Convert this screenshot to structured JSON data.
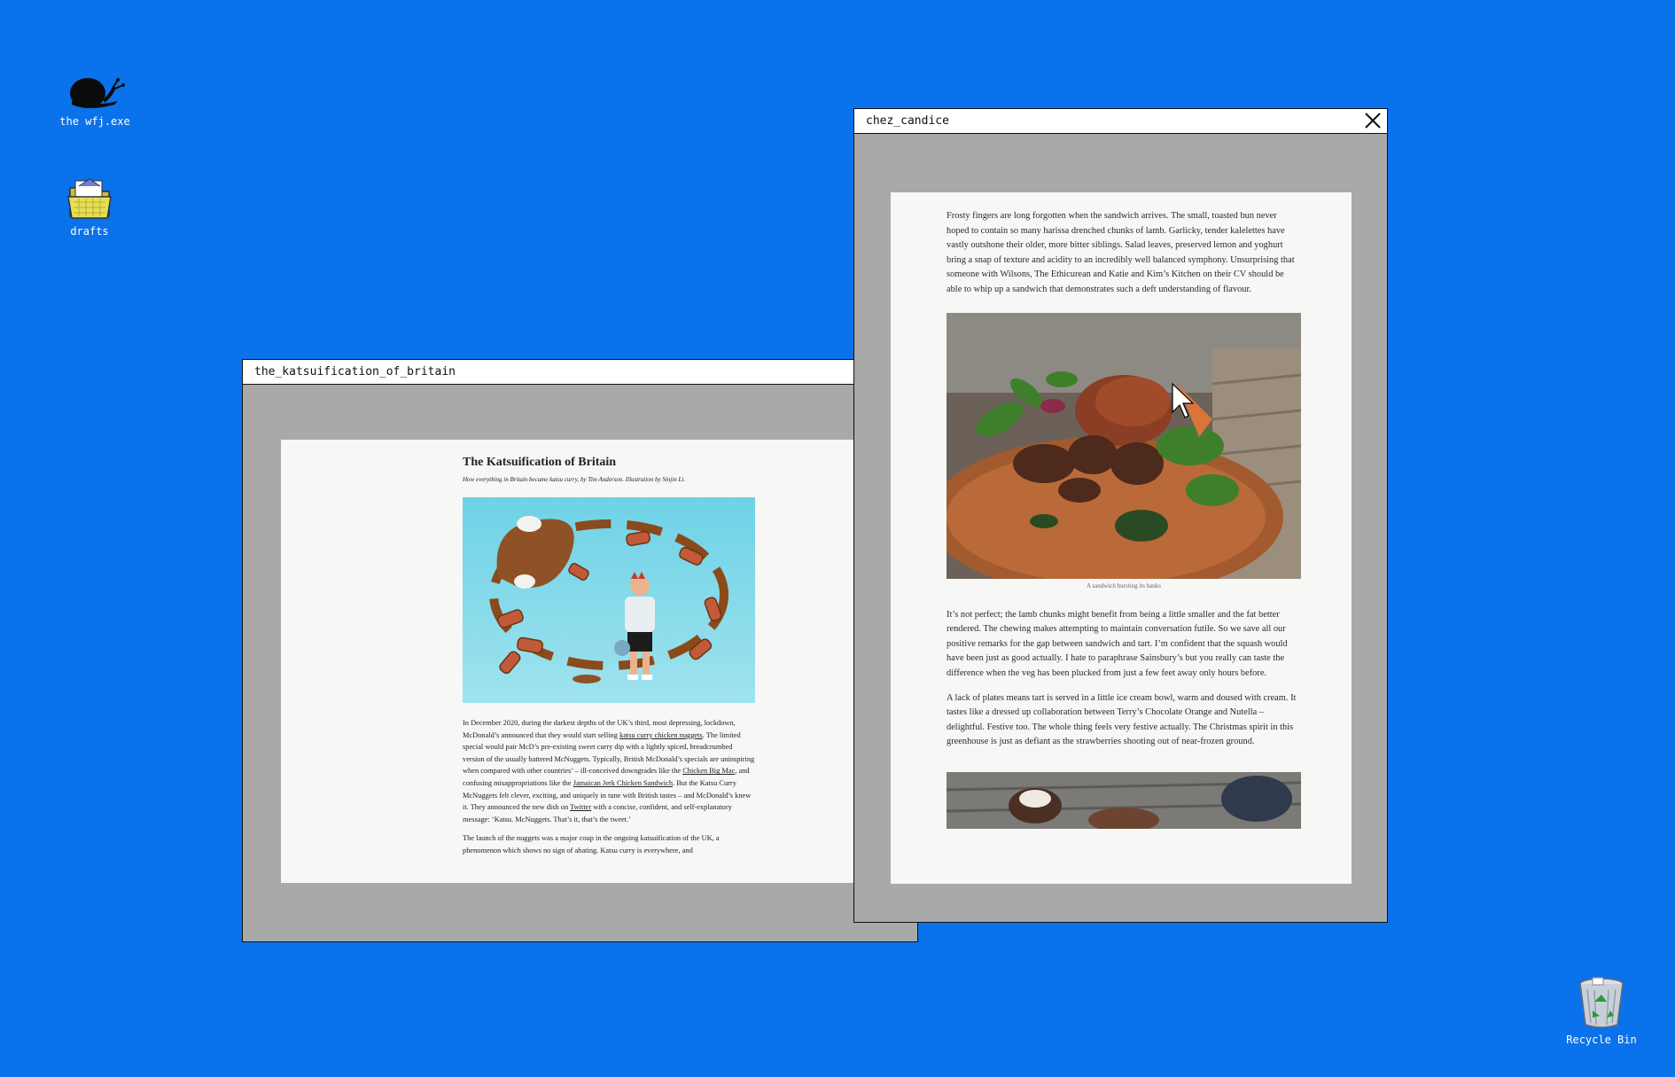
{
  "desktop": {
    "icons": [
      {
        "label": "the wfj.exe",
        "icon": "snail-icon"
      },
      {
        "label": "drafts",
        "icon": "folder-icon"
      }
    ],
    "recycle_bin": {
      "label": "Recycle Bin",
      "icon": "recycle-bin-icon"
    }
  },
  "katsu_window": {
    "title": "the_katsuification_of_britain",
    "article": {
      "heading": "The Katsuification of Britain",
      "subtitle": "How everything in Britain became katsu curry, by Tim Anderson. Illustration by Sinjin Li.",
      "illustration": "katsu-illustration",
      "p1": {
        "t1": "In December 2020, during the darkest depths of the UK’s third, most depressing, lockdown, McDonald’s announced that they would start selling ",
        "link1": "katsu curry chicken nuggets",
        "t2": ". The limited special would pair McD’s pre-existing sweet curry dip with a lightly spiced, breadcrumbed version of the usually battered McNuggets. Typically, British McDonald’s specials are uninspiring when compared with other countries’ – ill-conceived downgrades like the ",
        "link2": "Chicken Big Mac",
        "t3": ", and confusing misappropriations like the ",
        "link3": "Jamaican Jerk Chicken Sandwich",
        "t4": ". But the Katsu Curry McNuggets felt clever, exciting, and uniquely in tune with British tastes – and McDonald’s knew it. They announced the new dish on ",
        "link4": "Twitter",
        "t5": " with a concise, confident, and self-explanatory message: ‘Katsu. McNuggets. That’s it, that’s the tweet.’"
      },
      "p2": "The launch of the nuggets was a major coup in the ongoing katsuification of the UK, a phenomenon which shows no sign of abating. Katsu curry is everywhere, and"
    }
  },
  "candice_window": {
    "title": "chez_candice",
    "p1": "Frosty fingers are long forgotten when the sandwich arrives. The small, toasted bun never hoped to contain so many harissa drenched chunks of lamb. Garlicky, tender kalelettes have vastly outshone their older, more bitter siblings. Salad leaves, preserved lemon and yoghurt bring a snap of texture and acidity to an incredibly well balanced symphony. Unsurprising that someone with Wilsons, The Ethicurean and Katie and Kim’s Kitchen on their CV should be able to whip up a sandwich that demonstrates such a deft understanding of flavour.",
    "photo1_caption": "A sandwich bursting its banks",
    "p2": "It’s not perfect; the lamb chunks might benefit from being a little smaller and the fat better rendered. The chewing makes attempting to maintain conversation futile. So we save all our positive remarks for the gap between sandwich and tart. I’m confident that the squash would have been just as good actually. I hate to paraphrase Sainsbury’s but you really can taste the difference when the veg has been plucked from just a few feet away only hours before.",
    "p3": "A lack of plates means tart is served in a little ice cream bowl, warm and doused with cream. It tastes like a dressed up collaboration between Terry’s Chocolate Orange and Nutella – delightful. Festive too. The whole thing feels very festive actually. The Christmas spirit in this greenhouse is just as defiant as the strawberries shooting out of near-frozen ground."
  },
  "colors": {
    "desktop": "#0a72ea",
    "window_body": "#a9a9a9",
    "page": "#f7f7f5"
  }
}
